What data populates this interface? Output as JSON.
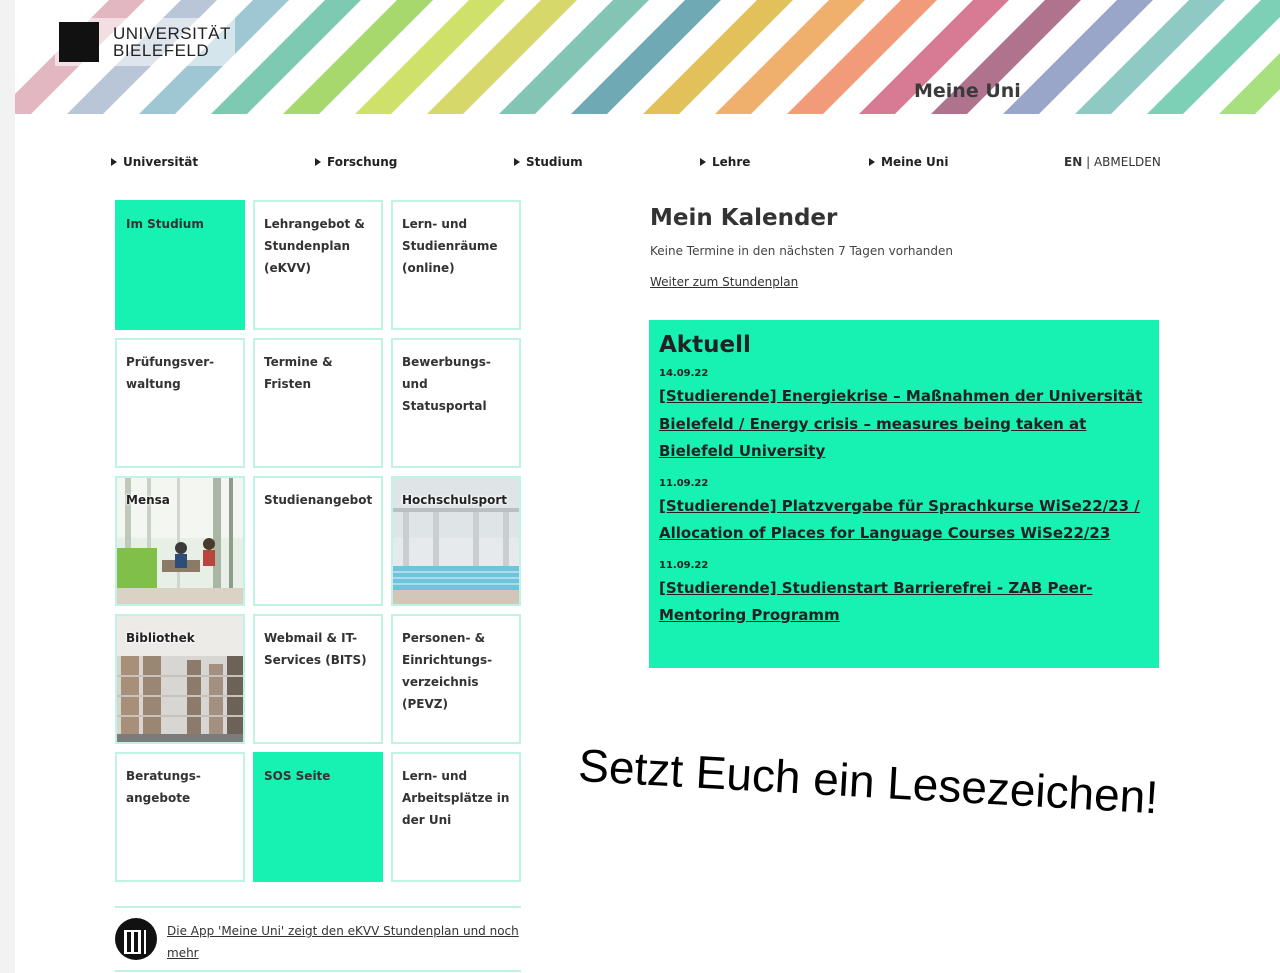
{
  "header": {
    "university_name": "UNIVERSITÄT BIELEFELD",
    "university_line1": "UNIVERSITÄT",
    "university_line2": "BIELEFELD",
    "banner_title": "Meine Uni"
  },
  "nav": {
    "items": [
      {
        "label": "Universität"
      },
      {
        "label": "Forschung"
      },
      {
        "label": "Studium"
      },
      {
        "label": "Lehre"
      },
      {
        "label": "Meine Uni"
      }
    ],
    "lang": "EN",
    "separator": "|",
    "logout": "ABMELDEN"
  },
  "tiles": [
    {
      "label": "Im Studium",
      "style": "green"
    },
    {
      "label": "Lehrangebot &\nStundenplan\n(eKVV)",
      "style": "plain"
    },
    {
      "label": "Lern- und\nStudienräume\n(online)",
      "style": "plain"
    },
    {
      "label": "Prüfungsver-\nwaltung",
      "style": "plain"
    },
    {
      "label": "Termine &\nFristen",
      "style": "plain"
    },
    {
      "label": "Bewerbungs- und\nStatusportal",
      "style": "plain"
    },
    {
      "label": "Mensa",
      "style": "photo"
    },
    {
      "label": "Studienangebot",
      "style": "plain"
    },
    {
      "label": "Hochschulsport",
      "style": "photo"
    },
    {
      "label": "Bibliothek",
      "style": "photo"
    },
    {
      "label": "Webmail & IT-\nServices (BITS)",
      "style": "plain"
    },
    {
      "label": "Personen- &\nEinrichtungs-\nverzeichnis\n(PEVZ)",
      "style": "plain"
    },
    {
      "label": "Beratungs-\nangebote",
      "style": "plain"
    },
    {
      "label": "SOS Seite",
      "style": "green"
    },
    {
      "label": "Lern- und\nArbeitsplätze in\nder Uni",
      "style": "plain"
    }
  ],
  "app_promo": {
    "text": "Die App 'Meine Uni' zeigt den eKVV Stundenplan und noch mehr"
  },
  "calendar": {
    "title": "Mein Kalender",
    "empty_text": "Keine Termine in den nächsten 7 Tagen vorhanden",
    "link": "Weiter zum Stundenplan"
  },
  "aktuell": {
    "title": "Aktuell",
    "news": [
      {
        "date": "14.09.22",
        "title": "[Studierende] Energiekrise – Maßnahmen der Universität Bielefeld / Energy crisis – measures being taken at Bielefeld University"
      },
      {
        "date": "11.09.22",
        "title": "[Studierende] Platzvergabe für Sprachkurse WiSe22/23 / Allocation of Places for Language Courses WiSe22/23"
      },
      {
        "date": "11.09.22",
        "title": "[Studierende] Studienstart Barrierefrei - ZAB Peer-Mentoring Programm"
      }
    ]
  },
  "note": "Setzt Euch ein Lesezeichen!",
  "colors": {
    "accent_green": "#17f2b3",
    "tile_border": "#bff4e4"
  }
}
